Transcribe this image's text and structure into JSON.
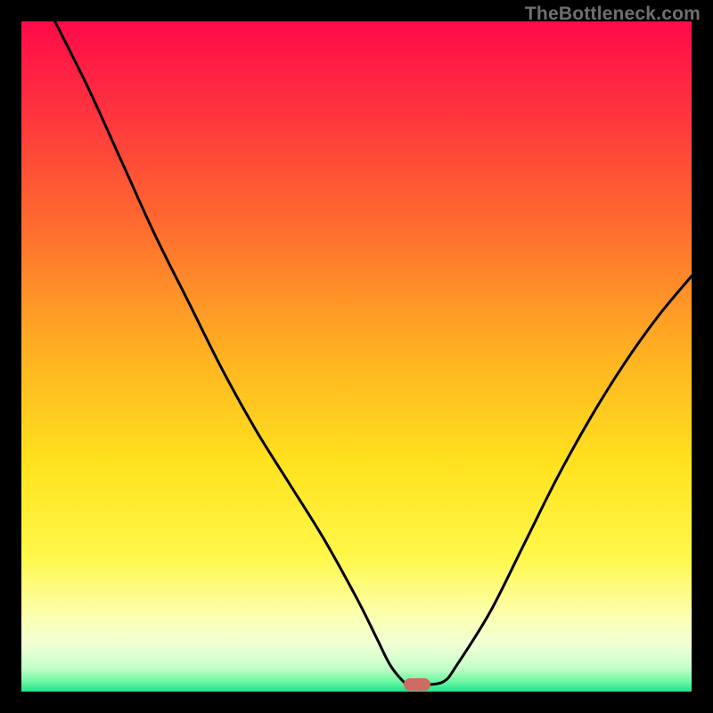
{
  "watermark": "TheBottleneck.com",
  "colors": {
    "frame": "#000000",
    "marker": "#cf6a62",
    "curve": "#000000",
    "gradient_stops": [
      {
        "pos": 0.0,
        "color": "#ff0a4a"
      },
      {
        "pos": 0.12,
        "color": "#ff2f3f"
      },
      {
        "pos": 0.3,
        "color": "#ff6a2f"
      },
      {
        "pos": 0.5,
        "color": "#ffb321"
      },
      {
        "pos": 0.66,
        "color": "#ffe21e"
      },
      {
        "pos": 0.8,
        "color": "#fff84a"
      },
      {
        "pos": 0.88,
        "color": "#fcffa8"
      },
      {
        "pos": 0.93,
        "color": "#f1ffd6"
      },
      {
        "pos": 0.965,
        "color": "#c4ffc8"
      },
      {
        "pos": 0.985,
        "color": "#6df7a3"
      },
      {
        "pos": 1.0,
        "color": "#1de28c"
      }
    ]
  },
  "chart_data": {
    "type": "line",
    "title": "",
    "xlabel": "",
    "ylabel": "",
    "xlim": [
      0,
      100
    ],
    "ylim": [
      0,
      100
    ],
    "series": [
      {
        "name": "bottleneck-curve",
        "x": [
          5,
          10,
          15,
          20,
          25,
          30,
          35,
          40,
          45,
          50,
          53,
          55,
          57,
          58,
          60,
          63,
          65,
          70,
          75,
          80,
          85,
          90,
          95,
          100
        ],
        "y": [
          100,
          90,
          79,
          68,
          58,
          48,
          39,
          31,
          23,
          14,
          8,
          4,
          1.5,
          1,
          1,
          1.5,
          4,
          12,
          22,
          32,
          41,
          49,
          56,
          62
        ]
      }
    ],
    "marker": {
      "x": 59,
      "y": 1
    },
    "flat_bottom": {
      "x_start": 57,
      "x_end": 63,
      "y": 1
    }
  }
}
